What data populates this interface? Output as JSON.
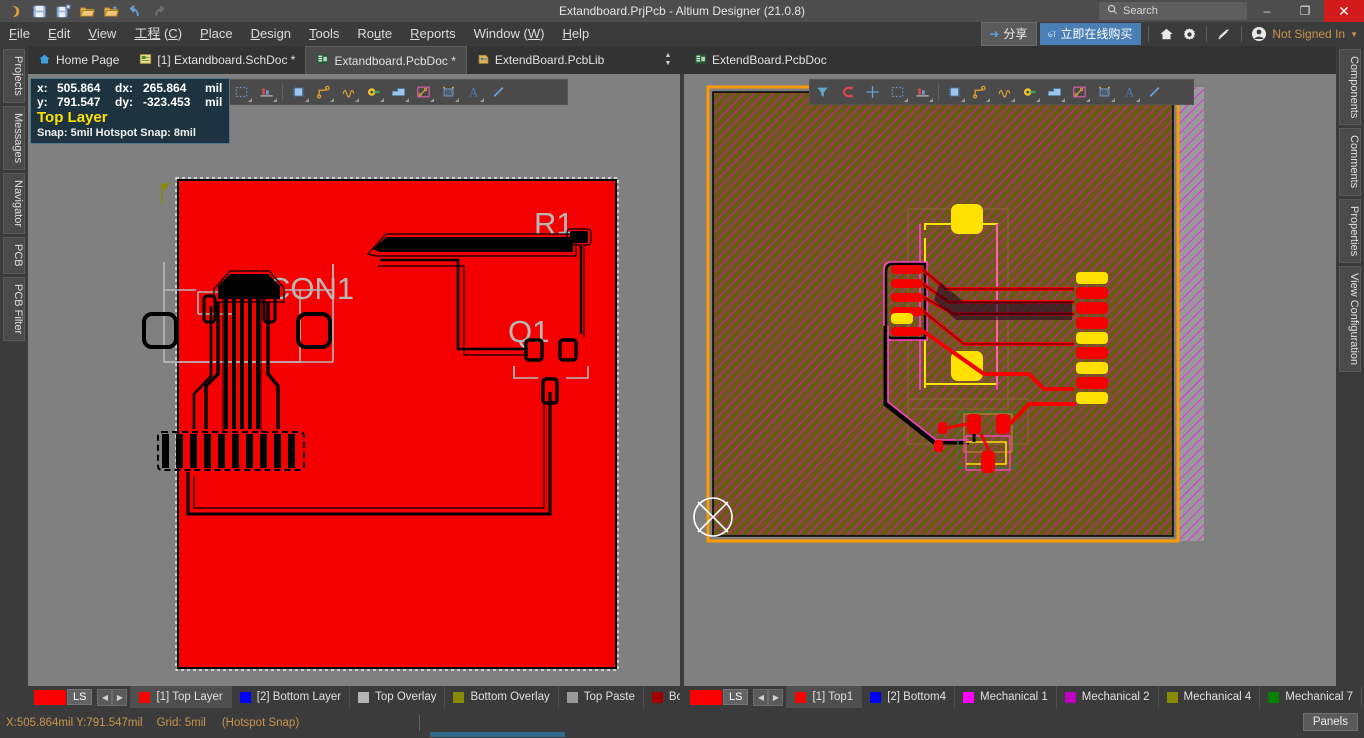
{
  "window": {
    "title": "Extandboard.PrjPcb - Altium Designer (21.0.8)",
    "minimize_label": "–",
    "maximize_label": "❐",
    "close_label": "✕"
  },
  "quick_access": [
    {
      "name": "altium-logo-icon",
      "glyph": "ʘ"
    },
    {
      "name": "save-icon",
      "glyph": "Ὃe"
    },
    {
      "name": "save-all-icon",
      "glyph": "Ὃe"
    },
    {
      "name": "open-icon",
      "glyph": "Ὄ1"
    },
    {
      "name": "open-project-icon",
      "glyph": "Ὄ2"
    },
    {
      "name": "undo-icon",
      "glyph": "↶"
    },
    {
      "name": "redo-icon",
      "glyph": "↷"
    }
  ],
  "search": {
    "placeholder": "Search",
    "icon": "search-icon"
  },
  "menu": {
    "items": [
      {
        "label": "File",
        "accel": "F"
      },
      {
        "label": "Edit",
        "accel": "E"
      },
      {
        "label": "View",
        "accel": "V"
      },
      {
        "label": "工程 (C)",
        "accel": "C"
      },
      {
        "label": "Place",
        "accel": "P"
      },
      {
        "label": "Design",
        "accel": "D"
      },
      {
        "label": "Tools",
        "accel": "T"
      },
      {
        "label": "Route",
        "accel": "u"
      },
      {
        "label": "Reports",
        "accel": "R"
      },
      {
        "label": "Window (W)",
        "accel": "W"
      },
      {
        "label": "Help",
        "accel": "H"
      }
    ],
    "share_label": "分享",
    "buy_label": "立即在线购买",
    "home_icon": "home-icon",
    "settings_icon": "gear-icon",
    "license_icon": "license-icon",
    "account_icon": "account-icon",
    "account_label": "Not Signed In"
  },
  "tabs_left": [
    {
      "label": "Home Page",
      "icon": "home-icon",
      "active": false
    },
    {
      "label": "[1] Extandboard.SchDoc *",
      "icon": "schematic-icon",
      "active": false
    },
    {
      "label": "Extandboard.PcbDoc *",
      "icon": "pcb-icon",
      "active": true
    },
    {
      "label": "ExtendBoard.PcbLib",
      "icon": "pcblib-icon",
      "active": false
    }
  ],
  "tabs_right": [
    {
      "label": "ExtendBoard.PcbDoc",
      "icon": "pcb-icon",
      "active": false
    }
  ],
  "dock_left": [
    "Projects",
    "Messages",
    "Navigator",
    "PCB",
    "PCB Filter"
  ],
  "dock_right": [
    "Components",
    "Comments",
    "Properties",
    "View Configuration"
  ],
  "hud": {
    "x_key": "x:",
    "x_value": "505.864",
    "dx_key": "dx:",
    "dx_value": "265.864",
    "dx_unit": "mil",
    "y_key": "y:",
    "y_value": "791.547",
    "dy_key": "dy:",
    "dy_value": "-323.453",
    "dy_unit": "mil",
    "layer": "Top Layer",
    "snap": "Snap: 5mil Hotspot Snap: 8mil"
  },
  "pcb_toolbar_left": [
    {
      "name": "select-area-icon",
      "glyph": "⬚"
    },
    {
      "name": "measure-icon",
      "glyph": "▐▐"
    },
    {
      "name": "place-component-icon",
      "glyph": "▣"
    },
    {
      "name": "interactive-routing-icon",
      "glyph": "↗"
    },
    {
      "name": "differential-pair-icon",
      "glyph": "∿"
    },
    {
      "name": "place-pad-icon",
      "glyph": "⚷"
    },
    {
      "name": "place-fill-icon",
      "glyph": "▭"
    },
    {
      "name": "place-polygon-icon",
      "glyph": "⬟"
    },
    {
      "name": "place-dimension-icon",
      "glyph": "⏺"
    },
    {
      "name": "place-string-icon",
      "glyph": "A"
    },
    {
      "name": "place-line-icon",
      "glyph": "╱"
    }
  ],
  "pcb_toolbar_right": [
    {
      "name": "filter-icon",
      "glyph": "▼"
    },
    {
      "name": "magnet-icon",
      "glyph": "⊃"
    },
    {
      "name": "crosshair-icon",
      "glyph": "✛"
    },
    {
      "name": "select-area-icon",
      "glyph": "⬚"
    },
    {
      "name": "measure-icon",
      "glyph": "▐▐"
    },
    {
      "name": "place-component-icon",
      "glyph": "▣"
    },
    {
      "name": "interactive-routing-icon",
      "glyph": "↗"
    },
    {
      "name": "differential-pair-icon",
      "glyph": "∿"
    },
    {
      "name": "place-pad-icon",
      "glyph": "⚷"
    },
    {
      "name": "place-fill-icon",
      "glyph": "▭"
    },
    {
      "name": "place-polygon-icon",
      "glyph": "⬟"
    },
    {
      "name": "place-dimension-icon",
      "glyph": "⏺"
    },
    {
      "name": "place-string-icon",
      "glyph": "A"
    },
    {
      "name": "place-line-icon",
      "glyph": "╱"
    }
  ],
  "canvas_left": {
    "designators": [
      "R1",
      "CON1",
      "Q1"
    ],
    "board_color": "#f50000",
    "outline_color": "#ffffff"
  },
  "canvas_right": {
    "plane_color": "#6b5a14",
    "keepout_color": "#ff9a00",
    "mechanical_color": "#ff00ff",
    "pad_top_color": "#f50000",
    "pad_multi_color": "#ffe100"
  },
  "layerbar_left": {
    "ls_label": "LS",
    "ls_color": "#ff0000",
    "prev_arrow": "◀",
    "next_arrow": "▶",
    "layers": [
      {
        "label": "[1] Top Layer",
        "color": "#ff0000",
        "active": true
      },
      {
        "label": "[2] Bottom Layer",
        "color": "#0000ff",
        "active": false
      },
      {
        "label": "Top Overlay",
        "color": "#b4b4b4",
        "active": false
      },
      {
        "label": "Bottom Overlay",
        "color": "#8b8b00",
        "active": false
      },
      {
        "label": "Top Paste",
        "color": "#9a9a9a",
        "active": false
      },
      {
        "label": "Bottom P",
        "color": "#a00000",
        "active": false
      }
    ]
  },
  "layerbar_right": {
    "ls_label": "LS",
    "ls_color": "#ff0000",
    "prev_arrow": "◀",
    "next_arrow": "▶",
    "layers": [
      {
        "label": "[1] Top1",
        "color": "#ff0000",
        "active": true
      },
      {
        "label": "[2] Bottom4",
        "color": "#0000ff",
        "active": false
      },
      {
        "label": "Mechanical 1",
        "color": "#ff00ff",
        "active": false
      },
      {
        "label": "Mechanical 2",
        "color": "#c000c0",
        "active": false
      },
      {
        "label": "Mechanical 4",
        "color": "#8b8b00",
        "active": false
      },
      {
        "label": "Mechanical 7",
        "color": "#008000",
        "active": false
      }
    ]
  },
  "statusbar": {
    "coords": "X:505.864mil Y:791.547mil",
    "grid": "Grid: 5mil",
    "snap_mode": "(Hotspot Snap)",
    "panels_label": "Panels"
  }
}
